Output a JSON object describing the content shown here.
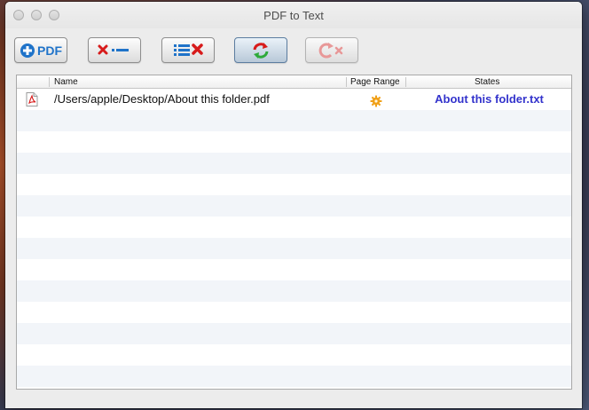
{
  "window": {
    "title": "PDF to Text"
  },
  "toolbar": {
    "add_pdf_label": "PDF"
  },
  "table": {
    "columns": [
      "Name",
      "Page Range",
      "States"
    ],
    "rows": [
      {
        "name": "/Users/apple/Desktop/About this folder.pdf",
        "page_range_icon": "gear-icon",
        "state": "About this folder.txt"
      }
    ]
  },
  "colors": {
    "state_link": "#3333cc",
    "accent_blue": "#1f73c9",
    "remove_red": "#d71b1b",
    "convert_green": "#2eaa3a",
    "gear_orange": "#f0a018",
    "row_alt": "#f2f5f9"
  }
}
